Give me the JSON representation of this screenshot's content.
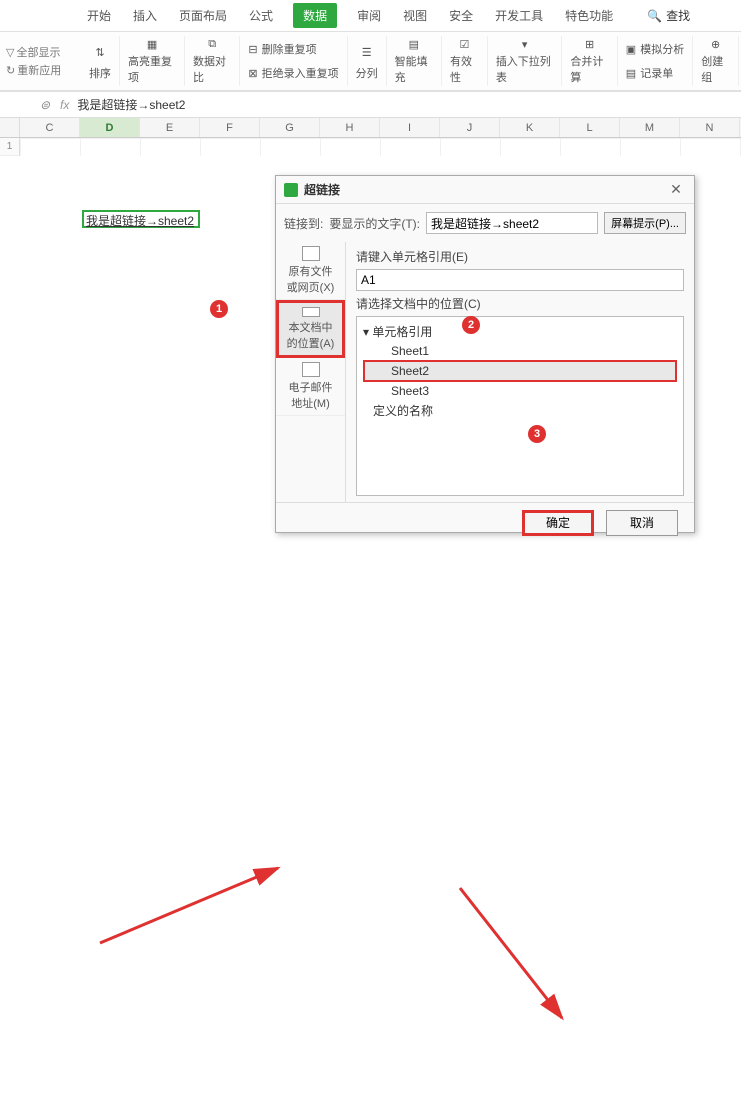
{
  "menu": {
    "tabs": [
      "开始",
      "插入",
      "页面布局",
      "公式",
      "数据",
      "审阅",
      "视图",
      "安全",
      "开发工具",
      "特色功能"
    ],
    "active": "数据",
    "search": "查找"
  },
  "ribbon": {
    "left1": "全部显示",
    "left2": "重新应用",
    "sort": "排序",
    "highlight": "高亮重复项",
    "compare": "数据对比",
    "dup1": "删除重复项",
    "dup2": "拒绝录入重复项",
    "split": "分列",
    "smart": "智能填充",
    "validity": "有效性",
    "insdrop": "插入下拉列表",
    "merge": "合并计算",
    "sim1": "模拟分析",
    "sim2": "记录单",
    "group": "创建组"
  },
  "formula": {
    "fx": "fx",
    "value": "我是超链接→sheet2"
  },
  "columns": [
    "C",
    "D",
    "E",
    "F",
    "G",
    "H",
    "I",
    "J",
    "K",
    "L",
    "M",
    "N"
  ],
  "rownum": "1",
  "cell_text": "我是超链接→sheet2",
  "dialog": {
    "title": "超链接",
    "linkto": "链接到:",
    "display_label": "要显示的文字(T):",
    "display_value": "我是超链接→sheet2",
    "tooltip_btn": "屏幕提示(P)...",
    "sidebar": {
      "existing": "原有文件\n或网页(X)",
      "indoc": "本文档中\n的位置(A)",
      "email": "电子邮件\n地址(M)"
    },
    "cellref_label": "请键入单元格引用(E)",
    "cellref_value": "A1",
    "select_label": "请选择文档中的位置(C)",
    "tree": {
      "root1": "单元格引用",
      "s1": "Sheet1",
      "s2": "Sheet2",
      "s3": "Sheet3",
      "root2": "定义的名称"
    },
    "ok": "确定",
    "cancel": "取消"
  },
  "markers": {
    "m1": "1",
    "m2": "2",
    "m3": "3"
  }
}
